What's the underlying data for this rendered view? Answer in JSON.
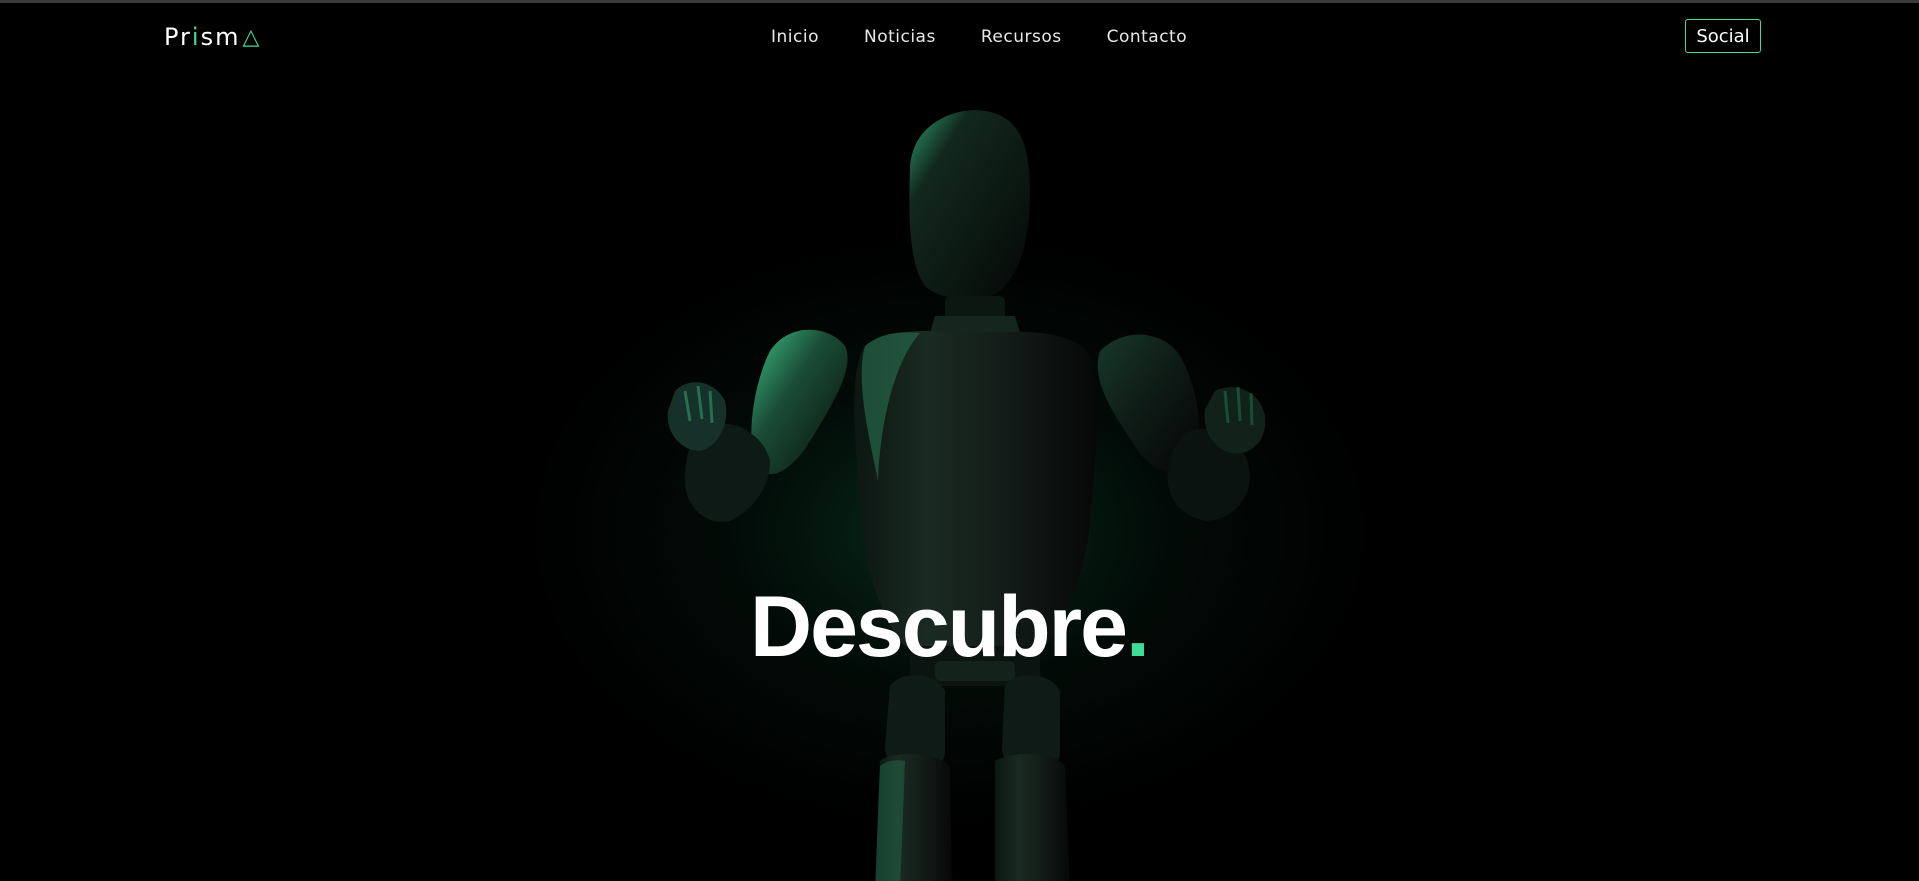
{
  "brand": {
    "name_start": "Pr",
    "name_accent": "i",
    "name_end": "sm",
    "accent_color": "#3ddc97"
  },
  "nav": {
    "items": [
      {
        "label": "Inicio"
      },
      {
        "label": "Noticias"
      },
      {
        "label": "Recursos"
      },
      {
        "label": "Contacto"
      }
    ]
  },
  "social_button": {
    "label": "Social"
  },
  "hero": {
    "title": "Descubre",
    "title_punct": ".",
    "image": "3d-robot-figure"
  },
  "colors": {
    "background": "#000000",
    "accent": "#3ddc97"
  }
}
